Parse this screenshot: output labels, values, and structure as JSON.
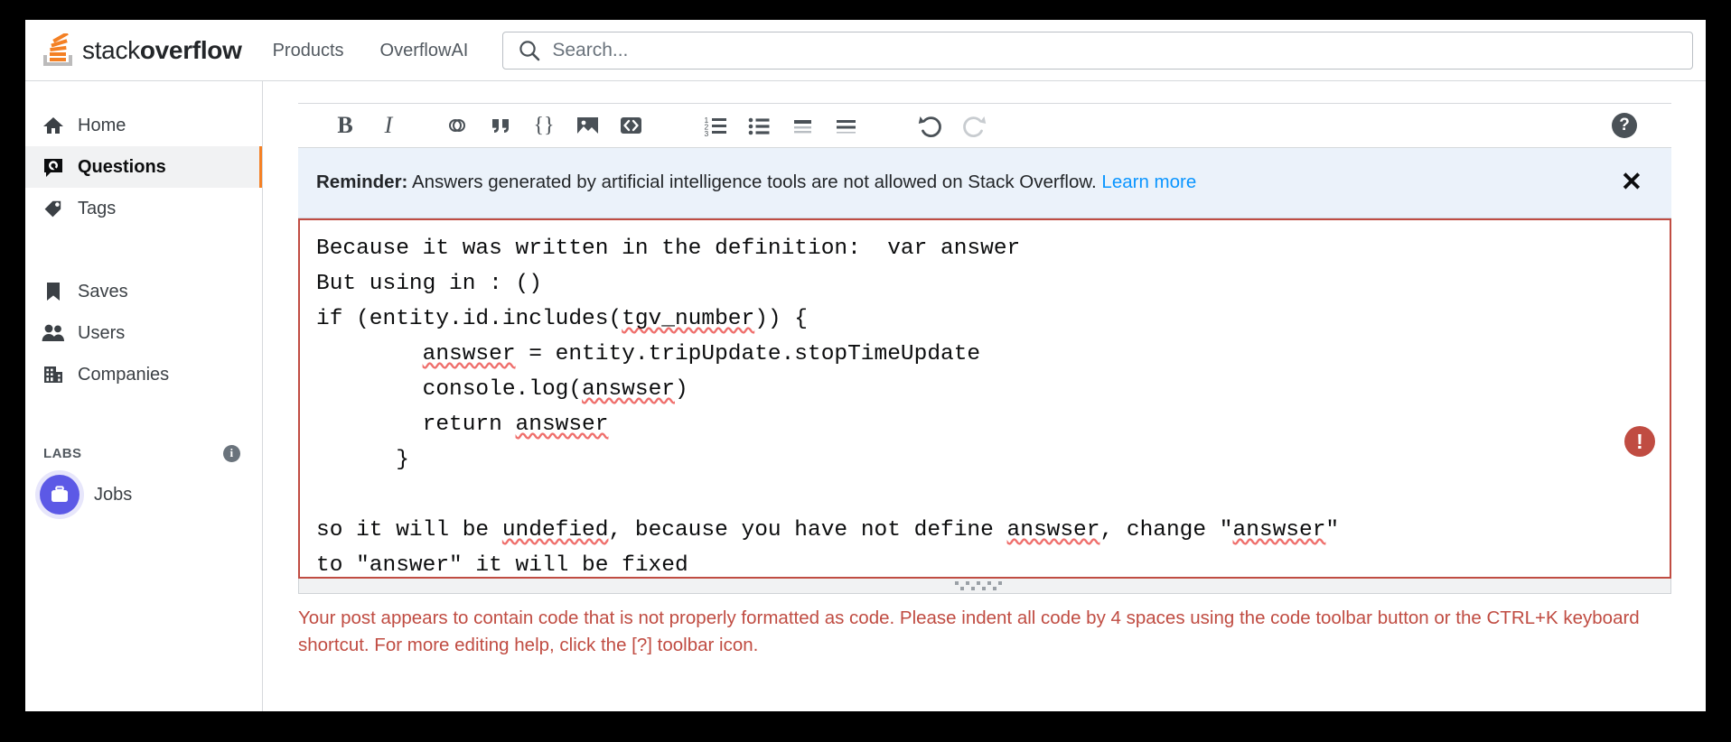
{
  "topnav": {
    "logo_text_light": "stack",
    "logo_text_bold": "overflow",
    "links": [
      {
        "label": "Products",
        "name": "nav-link-products"
      },
      {
        "label": "OverflowAI",
        "name": "nav-link-overflowai"
      }
    ],
    "search": {
      "placeholder": "Search...",
      "value": ""
    }
  },
  "sidebar": {
    "items": [
      {
        "label": "Home",
        "icon": "home-icon",
        "active": false
      },
      {
        "label": "Questions",
        "icon": "question-bubble-icon",
        "active": true
      },
      {
        "label": "Tags",
        "icon": "tag-icon",
        "active": false
      },
      {
        "label": "Saves",
        "icon": "bookmark-icon",
        "active": false
      },
      {
        "label": "Users",
        "icon": "users-icon",
        "active": false
      },
      {
        "label": "Companies",
        "icon": "building-icon",
        "active": false
      }
    ],
    "section_label": "LABS",
    "section_info_icon": "info-icon",
    "jobs": {
      "label": "Jobs",
      "icon": "briefcase-icon",
      "accent": "#5c59e6"
    }
  },
  "toolbar": {
    "buttons": [
      {
        "name": "bold-button",
        "glyph": "B",
        "label": "Bold"
      },
      {
        "name": "italic-button",
        "glyph": "I",
        "label": "Italic"
      },
      {
        "name": "link-button",
        "glyph": "link-icon",
        "label": "Hyperlink"
      },
      {
        "name": "blockquote-button",
        "glyph": "quote-icon",
        "label": "Blockquote"
      },
      {
        "name": "inline-code-button",
        "glyph": "{}",
        "label": "Inline code"
      },
      {
        "name": "image-button",
        "glyph": "image-icon",
        "label": "Image"
      },
      {
        "name": "code-block-button",
        "glyph": "code-icon",
        "label": "Code block"
      },
      {
        "name": "numbered-list-button",
        "glyph": "ordered-list-icon",
        "label": "Numbered list"
      },
      {
        "name": "bulleted-list-button",
        "glyph": "bulleted-list-icon",
        "label": "Bulleted list"
      },
      {
        "name": "heading-button",
        "glyph": "heading-icon",
        "label": "Heading"
      },
      {
        "name": "horizontal-rule-button",
        "glyph": "rule-icon",
        "label": "Horizontal rule"
      },
      {
        "name": "undo-button",
        "glyph": "undo-icon",
        "label": "Undo"
      },
      {
        "name": "redo-button",
        "glyph": "redo-icon",
        "label": "Redo",
        "disabled": true
      }
    ],
    "help_glyph": "?",
    "help_label": "Help"
  },
  "reminder": {
    "prefix": "Reminder:",
    "text": " Answers generated by artificial intelligence tools are not allowed on Stack Overflow. ",
    "link": "Learn more",
    "close_glyph": "✕",
    "background": "#ebf2fa",
    "link_color": "#0a95ff"
  },
  "editor": {
    "border_color": "#c04c42",
    "error_badge_glyph": "!",
    "lines": [
      {
        "text": "Because it was written in the definition:  var answer"
      },
      {
        "text": "But using in : ()"
      },
      {
        "text": "if (entity.id.includes(",
        "misspelled": "tgv_number",
        "after": ")) {"
      },
      {
        "text": "        ",
        "misspelled": "answser",
        "after": " = entity.tripUpdate.stopTimeUpdate"
      },
      {
        "text": "        console.log(",
        "misspelled": "answser",
        "after": ")"
      },
      {
        "text": "        return ",
        "misspelled": "answser",
        "after": ""
      },
      {
        "text": "      }"
      },
      {
        "text": ""
      },
      {
        "text": "so it will be ",
        "misspelled": "undefied",
        "after": ", because you have not define ",
        "misspelled2": "answser",
        "after2": ", change \"",
        "misspelled3": "answser",
        "after3": "\""
      },
      {
        "text": "to \"answer\" it will be fixed"
      }
    ],
    "full_text": "Because it was written in the definition:  var answer\nBut using in : ()\nif (entity.id.includes(tgv_number)) {\n        answser = entity.tripUpdate.stopTimeUpdate\n        console.log(answser)\n        return answser\n      }\n\nso it will be undefied, because you have not define answser, change \"answser\"\nto \"answer\" it will be fixed"
  },
  "validation": {
    "message": "Your post appears to contain code that is not properly formatted as code. Please indent all code by 4 spaces using the code toolbar button or the CTRL+K keyboard shortcut. For more editing help, click the [?] toolbar icon.",
    "color": "#c04c42"
  }
}
